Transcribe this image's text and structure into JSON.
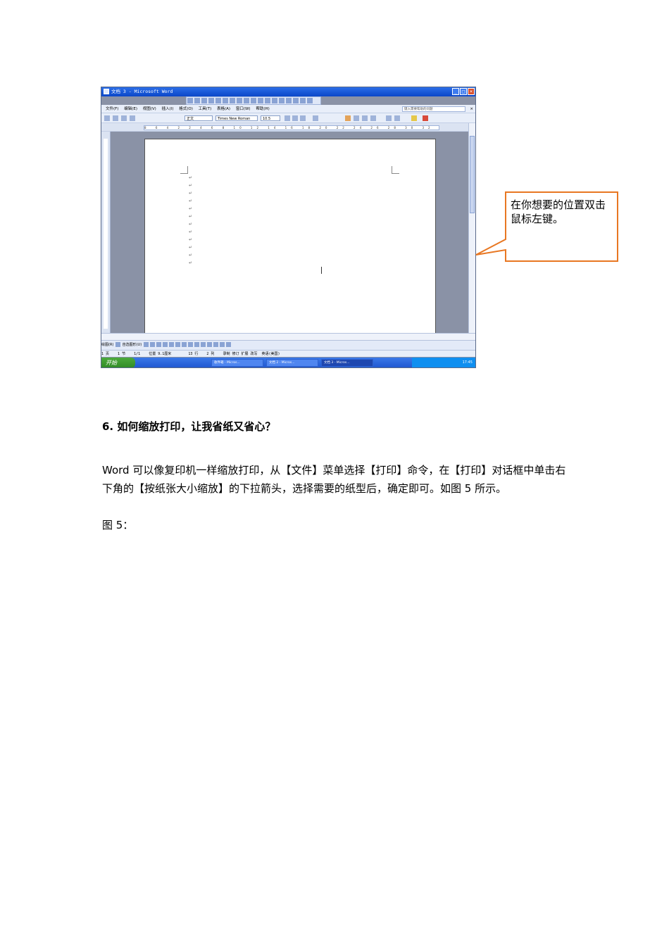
{
  "screenshot": {
    "window_title": "文档 3 - Microsoft Word",
    "menu_items": [
      "文件(F)",
      "编辑(E)",
      "视图(V)",
      "插入(I)",
      "格式(O)",
      "工具(T)",
      "表格(A)",
      "窗口(W)",
      "帮助(H)"
    ],
    "help_placeholder": "键入需要帮助的问题",
    "style_value": "正文",
    "font_value": "Times New Roman",
    "size_value": "10.5",
    "ruler_ticks": "8 6 4 2 2 4 6 8 10 12 14 16 18 20 22 24 26 28 30 32 34 36 38 40 42 44 46 48",
    "paragraph_mark": "↵",
    "status": "1 页    1 节    1/1    位置 9.1厘米        13 行    2 列    录制 修订 扩展 改写  英语(美国)",
    "start_label": "开始",
    "tasks": [
      "收件箱 - Micros...",
      "文档 2 - Micros...",
      "文档 3 - Micros..."
    ],
    "clock": "17:45",
    "draw_label": "绘图(R)",
    "autoshape_label": "自选图形(U)"
  },
  "callout": {
    "text": "在你想要的位置双击鼠标左键。",
    "border_color": "#e87722"
  },
  "section": {
    "heading": "6. 如何缩放打印，让我省纸又省心？",
    "paragraph": "Word 可以像复印机一样缩放打印，从【文件】菜单选择【打印】命令，在【打印】对话框中单击右下角的【按纸张大小缩放】的下拉箭头，选择需要的纸型后，确定即可。如图 5 所示。",
    "figure_label": "图 5："
  }
}
